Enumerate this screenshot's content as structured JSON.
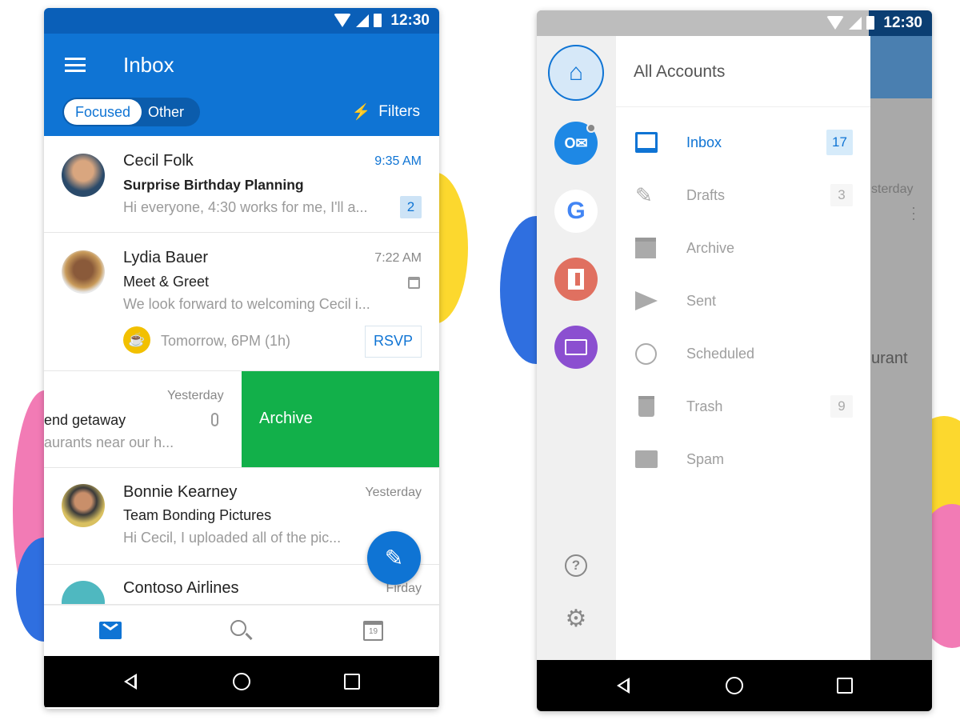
{
  "colors": {
    "brand": "#0f74d4",
    "archive_swipe": "#12b04a",
    "fab": "#0f74d4"
  },
  "left_phone": {
    "status": {
      "time": "12:30"
    },
    "header": {
      "title": "Inbox",
      "menu_icon": "hamburger-icon",
      "tabs": [
        {
          "label": "Focused",
          "selected": true
        },
        {
          "label": "Other",
          "selected": false
        }
      ],
      "filters_label": "Filters",
      "filters_icon": "lightning-icon"
    },
    "messages": [
      {
        "sender": "Cecil Folk",
        "time": "9:35 AM",
        "subject": "Surprise Birthday Planning",
        "preview": "Hi everyone, 4:30 works for me, I'll a...",
        "count": "2",
        "unread": true
      },
      {
        "sender": "Lydia Bauer",
        "time": "7:22 AM",
        "subject": "Meet & Greet",
        "preview": "We look forward to welcoming Cecil i...",
        "event_time": "Tomorrow, 6PM (1h)",
        "rsvp_label": "RSVP"
      },
      {
        "time": "Yesterday",
        "subject": "end getaway",
        "preview": "aurants near our h...",
        "swipe_action": "Archive"
      },
      {
        "sender": "Bonnie Kearney",
        "time": "Yesterday",
        "subject": "Team Bonding Pictures",
        "preview": "Hi Cecil, I uploaded all of the pic..."
      },
      {
        "sender": "Contoso Airlines",
        "time": "Firday"
      }
    ],
    "bottom_nav": [
      {
        "icon": "mail-icon",
        "active": true
      },
      {
        "icon": "search-icon"
      },
      {
        "icon": "calendar-icon",
        "label": "19"
      }
    ]
  },
  "right_phone": {
    "status": {
      "time": "12:30"
    },
    "accounts": [
      {
        "icon": "home-icon",
        "selected": true
      },
      {
        "icon": "outlook-icon"
      },
      {
        "icon": "google-icon",
        "label": "G"
      },
      {
        "icon": "office-icon"
      },
      {
        "icon": "mail-account-icon"
      }
    ],
    "rail_bottom": [
      {
        "icon": "help-icon",
        "label": "?"
      },
      {
        "icon": "settings-icon"
      }
    ],
    "drawer_title": "All Accounts",
    "folders": [
      {
        "label": "Inbox",
        "icon": "inbox-icon",
        "count": "17",
        "selected": true
      },
      {
        "label": "Drafts",
        "icon": "drafts-icon",
        "count": "3"
      },
      {
        "label": "Archive",
        "icon": "archive-icon"
      },
      {
        "label": "Sent",
        "icon": "sent-icon"
      },
      {
        "label": "Scheduled",
        "icon": "clock-icon"
      },
      {
        "label": "Trash",
        "icon": "trash-icon",
        "count": "9"
      },
      {
        "label": "Spam",
        "icon": "spam-icon"
      }
    ],
    "background_peek": {
      "time": "sterday",
      "text": "urant"
    }
  }
}
